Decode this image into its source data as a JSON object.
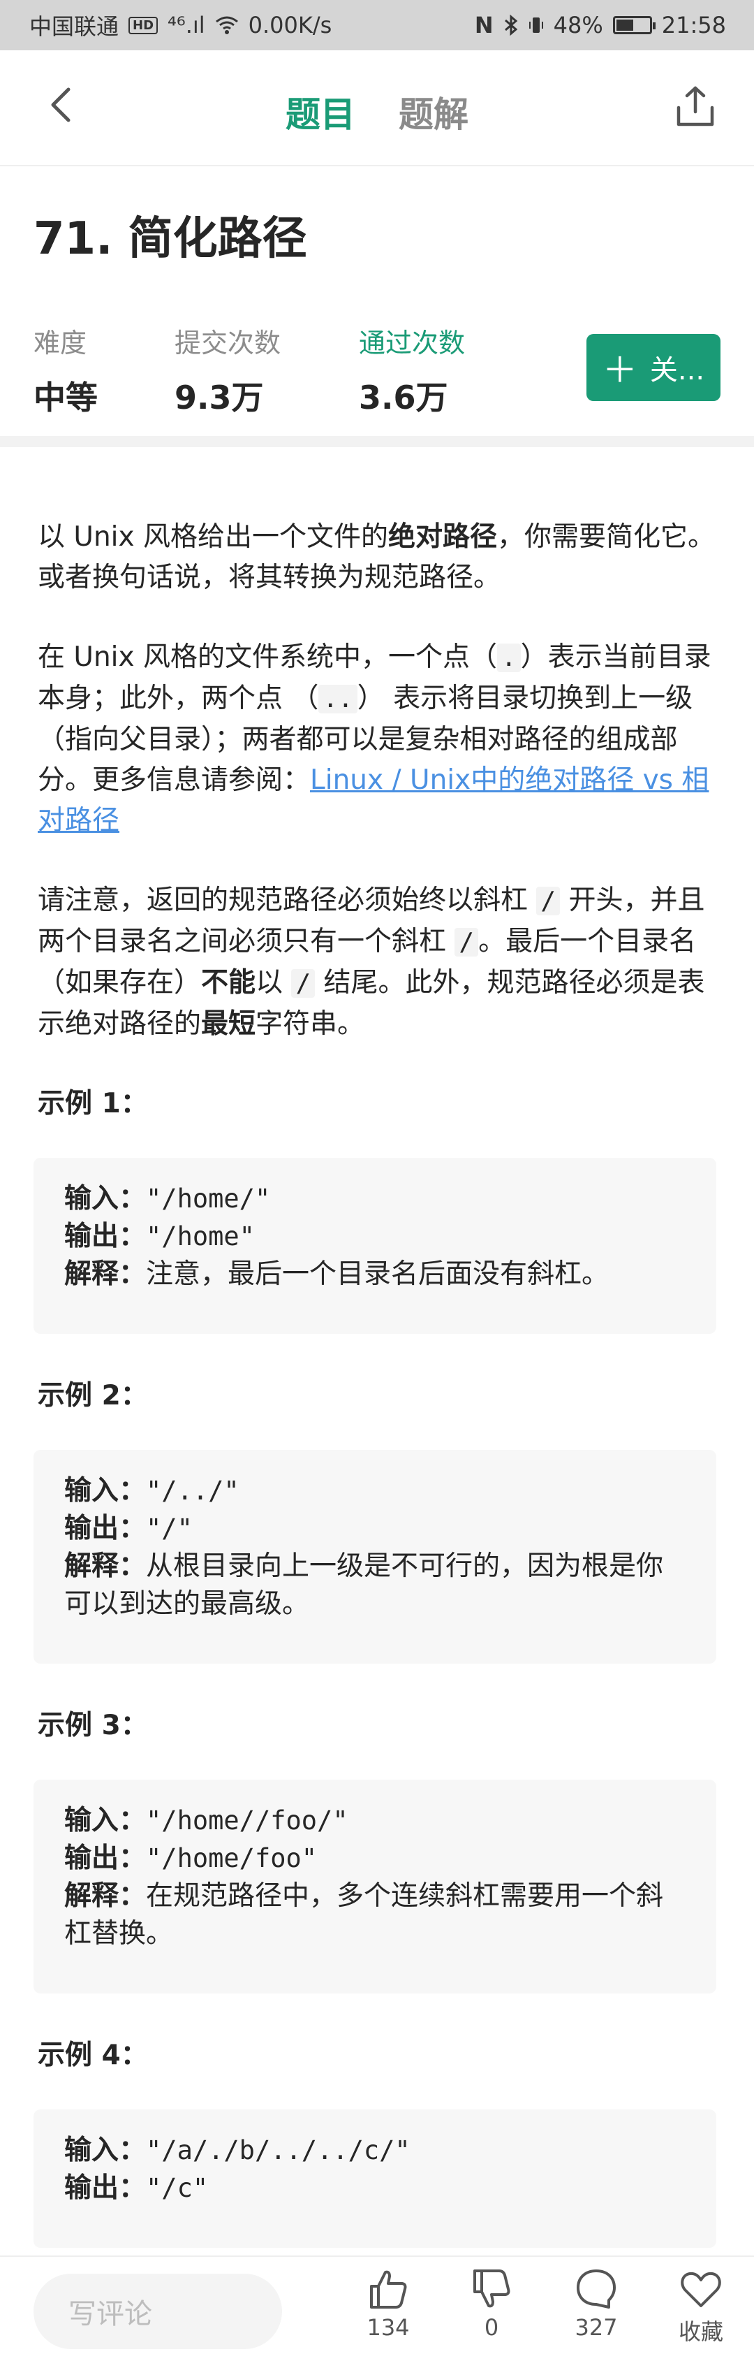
{
  "status_bar": {
    "carrier": "中国联通",
    "hd": "HD",
    "signal": "⁴⁶.ıl",
    "speed": "0.00K/s",
    "nfc": "N",
    "battery_pct": "48%",
    "battery_level": 0.48,
    "time": "21:58"
  },
  "nav": {
    "tab_problem": "题目",
    "tab_solution": "题解"
  },
  "problem": {
    "title": "71. 简化路径",
    "stats": {
      "difficulty_label": "难度",
      "difficulty_value": "中等",
      "submissions_label": "提交次数",
      "submissions_value": "9.3万",
      "accepted_label": "通过次数",
      "accepted_value": "3.6万"
    },
    "follow_label": "关..."
  },
  "content": {
    "p1_a": "以 Unix 风格给出一个文件的",
    "p1_b": "绝对路径",
    "p1_c": "，你需要简化它。或者换句话说，将其转换为规范路径。",
    "p2_a": "在 Unix 风格的文件系统中，一个点（",
    "p2_code1": ".",
    "p2_b": "）表示当前目录本身；此外，两个点 （",
    "p2_code2": "..",
    "p2_c": "） 表示将目录切换到上一级（指向父目录）；两者都可以是复杂相对路径的组成部分。更多信息请参阅：",
    "p2_link": "Linux / Unix中的绝对路径 vs 相对路径",
    "p3_a": "请注意，返回的规范路径必须始终以斜杠 ",
    "p3_code1": "/",
    "p3_b": " 开头，并且两个目录名之间必须只有一个斜杠 ",
    "p3_code2": "/",
    "p3_c": "。最后一个目录名（如果存在）",
    "p3_bold1": "不能",
    "p3_d": "以 ",
    "p3_code3": "/",
    "p3_e": " 结尾。此外，规范路径必须是表示绝对路径的",
    "p3_bold2": "最短",
    "p3_f": "字符串。"
  },
  "examples": [
    {
      "title": "示例 1：",
      "input_label": "输入：",
      "input": "\"/home/\"",
      "output_label": "输出：",
      "output": "\"/home\"",
      "explain_label": "解释：",
      "explain": "注意，最后一个目录名后面没有斜杠。"
    },
    {
      "title": "示例 2：",
      "input_label": "输入：",
      "input": "\"/../\"",
      "output_label": "输出：",
      "output": "\"/\"",
      "explain_label": "解释：",
      "explain": "从根目录向上一级是不可行的，因为根是你可以到达的最高级。"
    },
    {
      "title": "示例 3：",
      "input_label": "输入：",
      "input": "\"/home//foo/\"",
      "output_label": "输出：",
      "output": "\"/home/foo\"",
      "explain_label": "解释：",
      "explain": "在规范路径中，多个连续斜杠需要用一个斜杠替换。"
    },
    {
      "title": "示例 4：",
      "input_label": "输入：",
      "input": "\"/a/./b/../../c/\"",
      "output_label": "输出：",
      "output": "\"/c\""
    }
  ],
  "bottom_bar": {
    "comment_placeholder": "写评论",
    "like_count": "134",
    "dislike_count": "0",
    "comment_count": "327",
    "favorite_label": "收藏"
  },
  "colors": {
    "accent": "#1a9b76",
    "link": "#4a90e2"
  }
}
